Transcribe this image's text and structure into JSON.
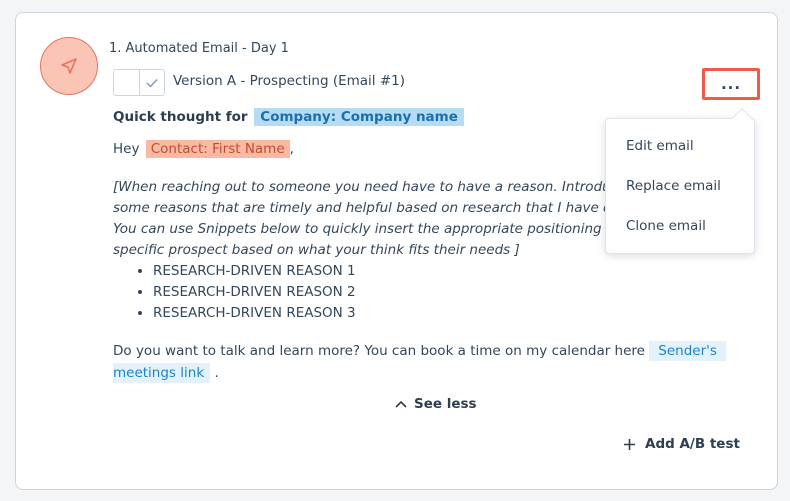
{
  "step": {
    "title": "1. Automated Email - Day 1",
    "icon": "send-icon",
    "icon_bg": "#fbc5b5",
    "icon_color": "#e9735b"
  },
  "version": {
    "label": "Version A - Prospecting (Email #1)"
  },
  "more_button": {
    "label": "...",
    "highlight_color": "#ef5b46"
  },
  "email": {
    "subject_prefix": "Quick thought for",
    "subject_token": "Company: Company name",
    "greeting": "Hey",
    "greeting_token": "Contact: First Name",
    "greeting_suffix": ",",
    "italic_lines": [
      "[When reaching out to someone you need have to have a reason. Introduc",
      "some reasons that are timely and helpful based on research that I have do",
      "You can use Snippets below to quickly insert the appropriate positioning st",
      "specific prospect based on what your think fits their needs ]"
    ],
    "reasons": [
      "RESEARCH-DRIVEN REASON 1",
      "RESEARCH-DRIVEN REASON 2",
      "RESEARCH-DRIVEN REASON 3"
    ],
    "closing_text": "Do you want to talk and learn more? You can book a time on my calendar here",
    "closing_token_line1": "Sender's",
    "closing_token_line2": "meetings link",
    "closing_suffix": "."
  },
  "see_less_label": "See less",
  "add_ab_label": "Add A/B test",
  "dropdown": {
    "items": [
      "Edit email",
      "Replace email",
      "Clone email"
    ]
  },
  "colors": {
    "token_blue_bg": "#b6dcf3",
    "token_orange_bg": "#fbb9a3",
    "link_bg": "#e3f1fb"
  }
}
